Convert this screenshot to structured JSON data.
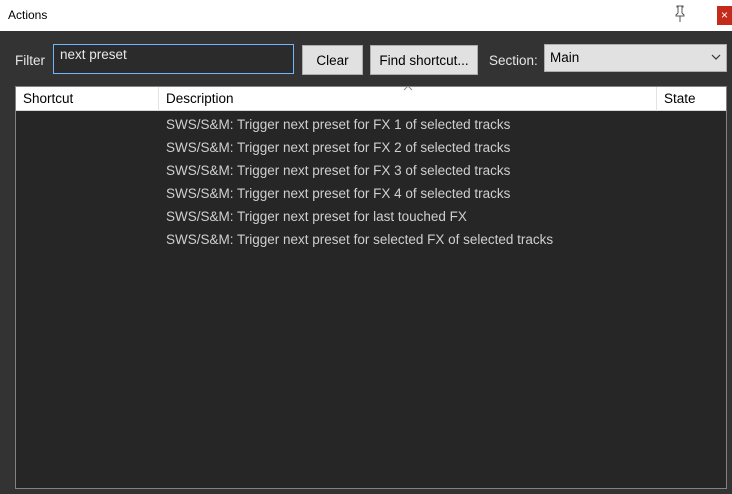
{
  "window": {
    "title": "Actions",
    "close_glyph": "×"
  },
  "filter": {
    "label": "Filter",
    "value": "next preset"
  },
  "buttons": {
    "clear_label": "Clear",
    "find_shortcut_label": "Find shortcut..."
  },
  "section": {
    "label": "Section:",
    "selected": "Main"
  },
  "table": {
    "columns": {
      "shortcut": "Shortcut",
      "description": "Description",
      "state": "State"
    },
    "rows": [
      {
        "shortcut": "",
        "description": "SWS/S&M: Trigger next preset for FX 1 of selected tracks",
        "state": ""
      },
      {
        "shortcut": "",
        "description": "SWS/S&M: Trigger next preset for FX 2 of selected tracks",
        "state": ""
      },
      {
        "shortcut": "",
        "description": "SWS/S&M: Trigger next preset for FX 3 of selected tracks",
        "state": ""
      },
      {
        "shortcut": "",
        "description": "SWS/S&M: Trigger next preset for FX 4 of selected tracks",
        "state": ""
      },
      {
        "shortcut": "",
        "description": "SWS/S&M: Trigger next preset for last touched FX",
        "state": ""
      },
      {
        "shortcut": "",
        "description": "SWS/S&M: Trigger next preset for selected FX of selected tracks",
        "state": ""
      }
    ]
  },
  "icons": {
    "pin": "pin-icon",
    "close": "close-icon",
    "dropdown": "chevron-down-icon",
    "sort": "sort-caret-icon"
  },
  "colors": {
    "window_bg": "#333333",
    "list_bg": "#262626",
    "input_focus_border": "#6fb7ff",
    "close_bg": "#c42b1c"
  }
}
